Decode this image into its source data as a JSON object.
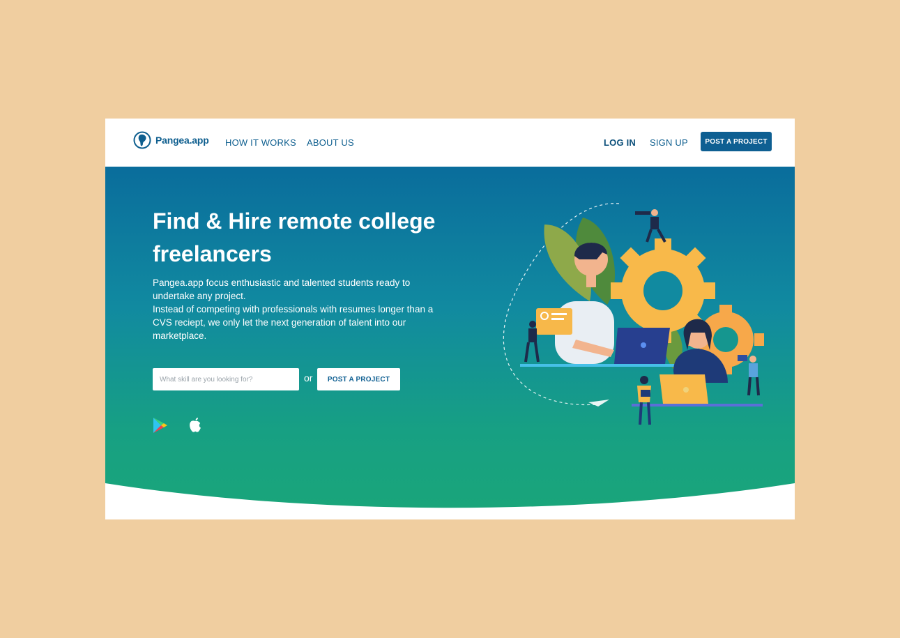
{
  "brand": {
    "name": "Pangea.app",
    "color": "#0f5f8f"
  },
  "nav": {
    "links": [
      "HOW IT WORKS",
      "ABOUT US"
    ],
    "login": "LOG IN",
    "signup": "SIGN UP",
    "cta": "POST A PROJECT"
  },
  "hero": {
    "title": "Find & Hire remote college freelancers",
    "description": [
      "Pangea.app focus enthusiastic and talented students ready to undertake any project.",
      "Instead of competing with professionals with resumes longer than a CVS reciept, we only let the next generation of talent into our marketplace."
    ],
    "search_placeholder": "What skill are you looking for?",
    "or_text": "or",
    "cta": "POST A PROJECT",
    "stores": [
      "google-play-icon",
      "apple-icon"
    ]
  },
  "colors": {
    "background": "#f0cea0",
    "hero_top": "#0a6d9c",
    "hero_bottom": "#1aa679",
    "accent": "#0e5f92"
  }
}
